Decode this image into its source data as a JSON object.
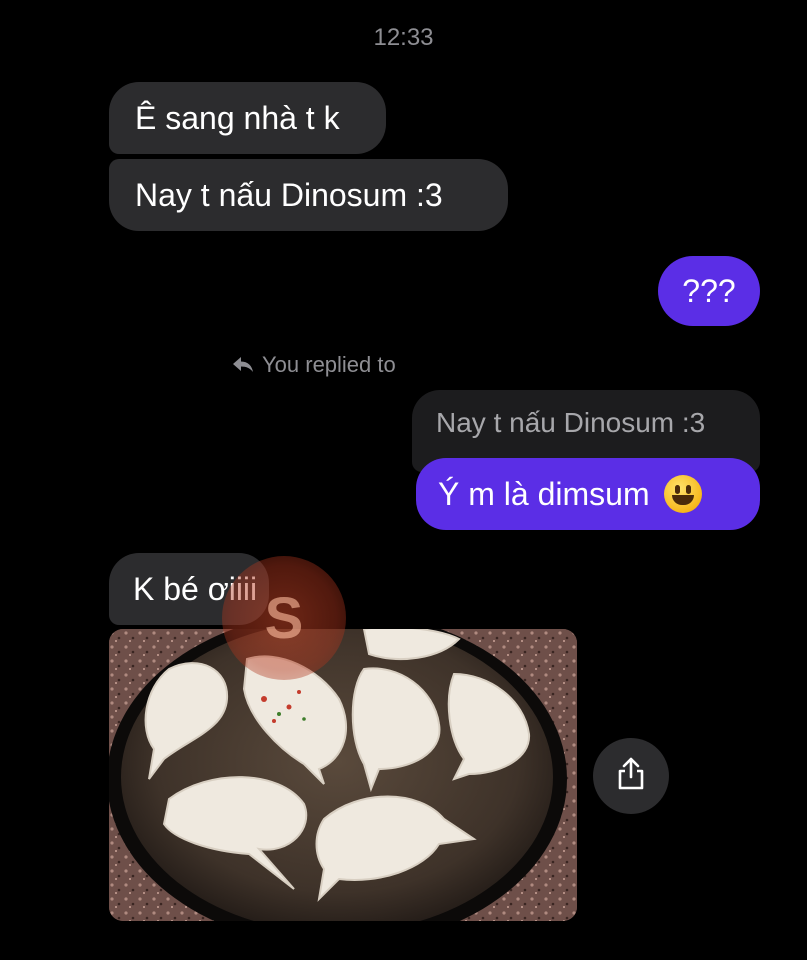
{
  "chat": {
    "timestamp": "12:33",
    "messages": [
      {
        "from": "them",
        "text": "Ê sang nhà t k"
      },
      {
        "from": "them",
        "text": "Nay t nấu Dinosum :3"
      },
      {
        "from": "me",
        "text": "???"
      },
      {
        "from": "me",
        "reply_label": "You replied to",
        "quoted_text": "Nay t nấu Dinosum :3",
        "text": "Ý m là dimsum",
        "emoji": "grinning-face"
      },
      {
        "from": "them",
        "text": "K bé ơiiii"
      }
    ]
  },
  "photo": {
    "subject": "dinosaur-shaped dumplings on a baking pan"
  },
  "icons": {
    "reply": "reply-arrow-icon",
    "share": "share-icon"
  },
  "colors": {
    "sent_bubble": "#5b2ee6",
    "received_bubble": "#2c2c2e",
    "background": "#000000",
    "meta_text": "#8e8e93"
  }
}
